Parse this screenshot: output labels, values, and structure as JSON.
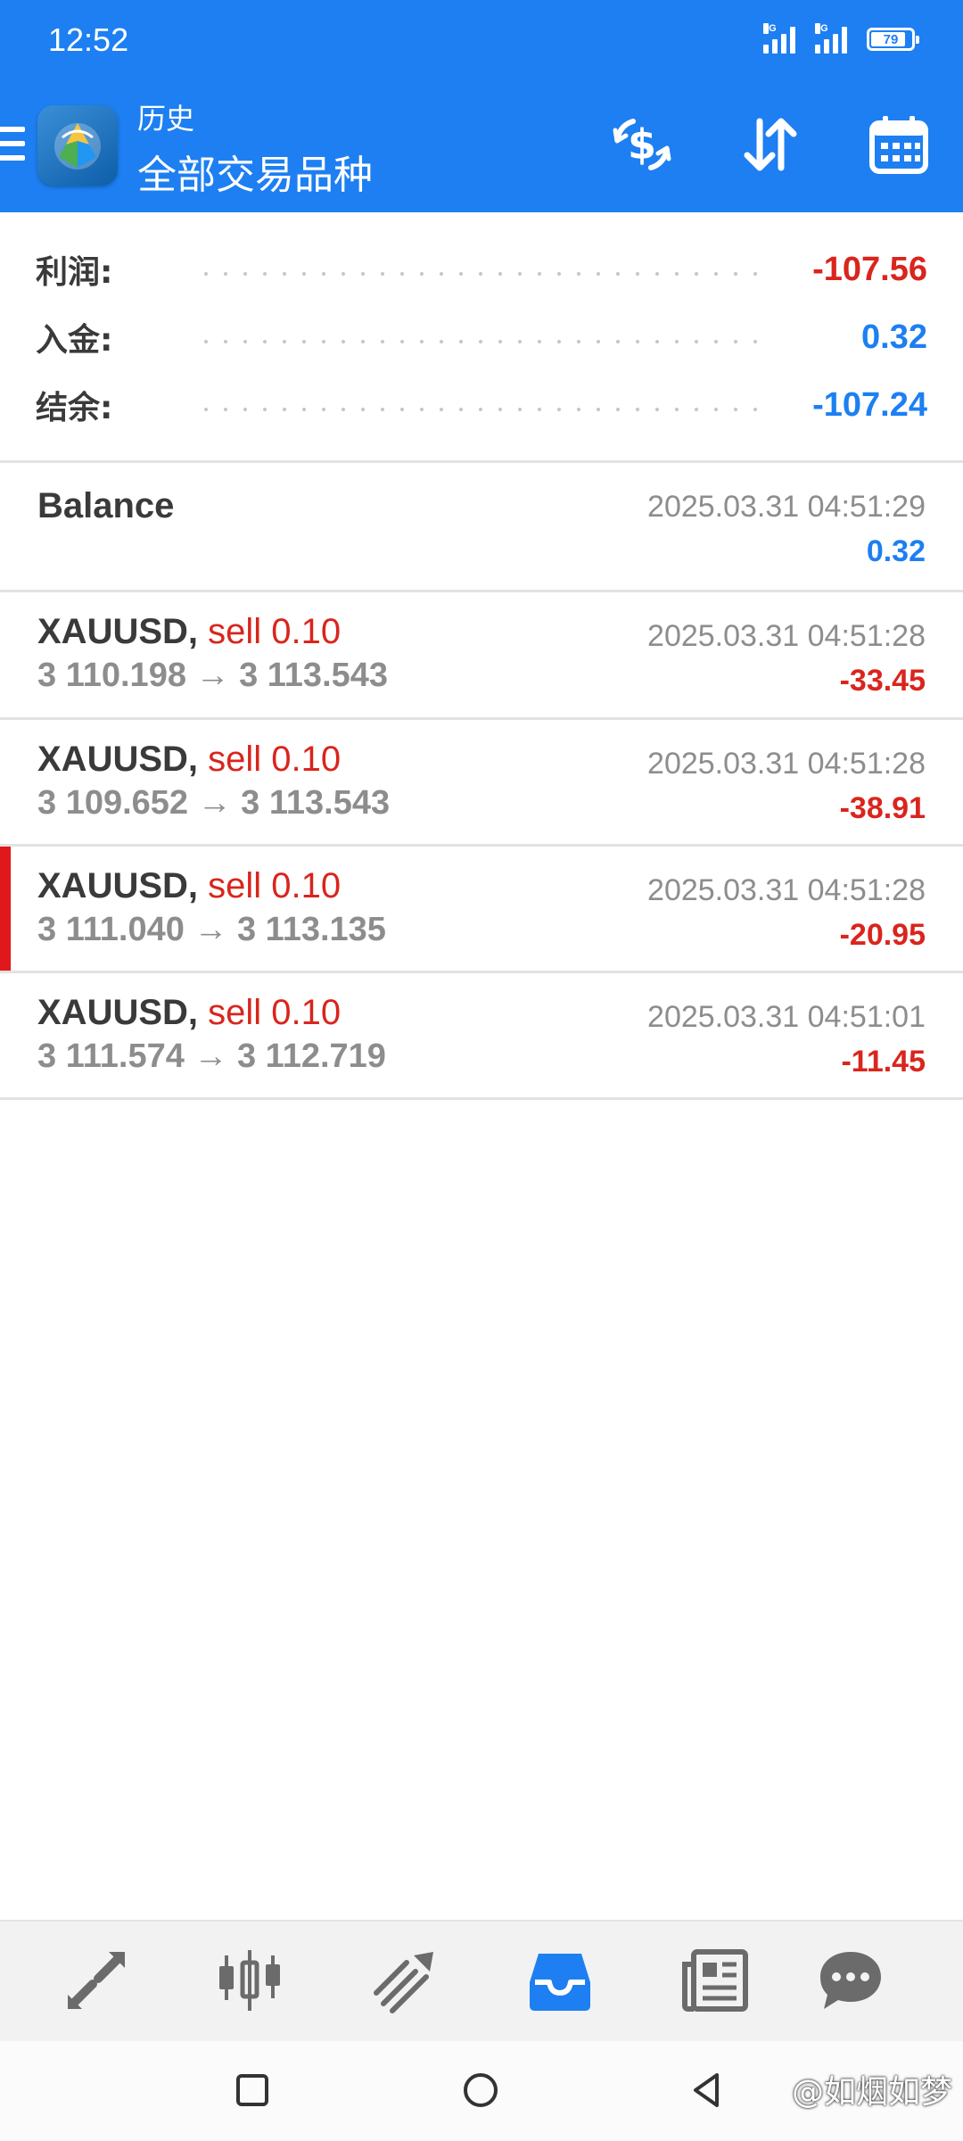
{
  "status_bar": {
    "time": "12:52",
    "signal1_tag": "5G",
    "signal2_tag": "5G",
    "battery": "79"
  },
  "header": {
    "subtitle": "历史",
    "title": "全部交易品种",
    "accent_color": "#1d7ff2"
  },
  "summary": {
    "profit_label": "利润:",
    "profit_value": "-107.56",
    "deposit_label": "入金:",
    "deposit_value": "0.32",
    "balance_label": "结余:",
    "balance_value": "-107.24"
  },
  "balance_entry": {
    "title": "Balance",
    "time": "2025.03.31 04:51:29",
    "amount": "0.32"
  },
  "deals": [
    {
      "symbol": "XAUUSD,",
      "type": "sell 0.10",
      "prices": "3 110.198 → 3 113.543",
      "time": "2025.03.31 04:51:28",
      "profit": "-33.45"
    },
    {
      "symbol": "XAUUSD,",
      "type": "sell 0.10",
      "prices": "3 109.652 → 3 113.543",
      "time": "2025.03.31 04:51:28",
      "profit": "-38.91"
    },
    {
      "symbol": "XAUUSD,",
      "type": "sell 0.10",
      "prices": "3 111.040 → 3 113.135",
      "time": "2025.03.31 04:51:28",
      "profit": "-20.95"
    },
    {
      "symbol": "XAUUSD,",
      "type": "sell 0.10",
      "prices": "3 111.574 → 3 112.719",
      "time": "2025.03.31 04:51:01",
      "profit": "-11.45"
    }
  ],
  "tabs": [
    {
      "icon": "quotes-arrows-icon"
    },
    {
      "icon": "candlestick-chart-icon"
    },
    {
      "icon": "trade-trend-icon"
    },
    {
      "icon": "history-inbox-icon",
      "active": true
    },
    {
      "icon": "news-icon"
    },
    {
      "icon": "chat-icon"
    }
  ],
  "watermark": "@如烟如梦",
  "colors": {
    "negative": "#d9251d",
    "positive": "#1d7ff2",
    "muted": "#8d8d8d"
  }
}
